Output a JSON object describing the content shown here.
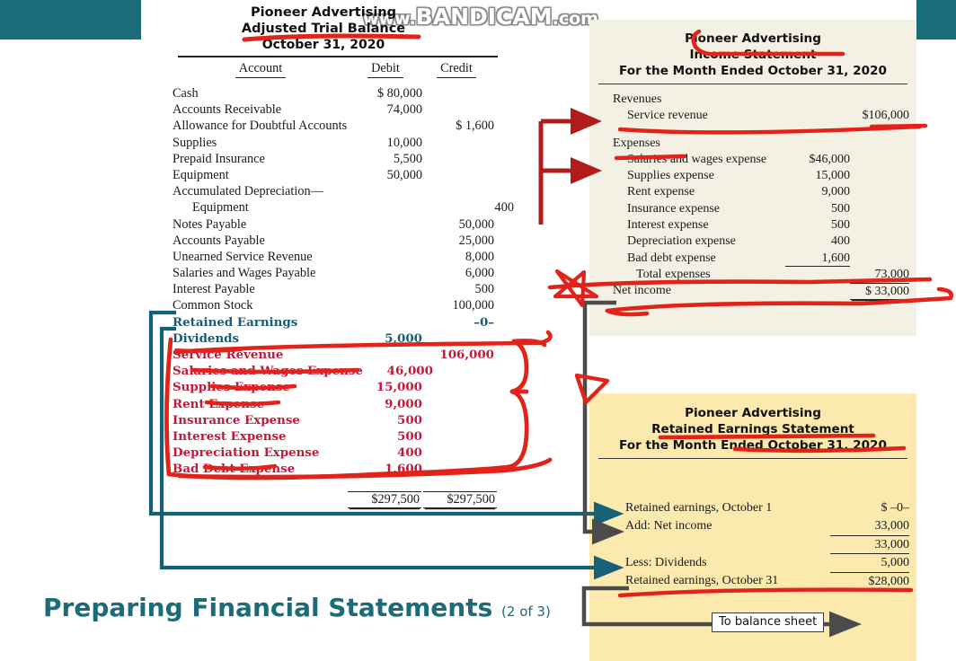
{
  "watermark": {
    "prefix": "www.",
    "brand": "BANDICAM",
    "suffix": ".com"
  },
  "colors": {
    "teal": "#1b6b78",
    "red_annotation": "#e2231a",
    "dark_red_arrow": "#b01c1c",
    "cream_panel": "#f2f1e4",
    "yellow_panel": "#fbe9ae",
    "gray_connector": "#4b4b4b",
    "teal_connector": "#16607a",
    "red_text": "#c2183c"
  },
  "page_title": {
    "text": "Preparing Financial Statements",
    "count": "(2 of 3)"
  },
  "to_balance_sheet": {
    "label": "To balance sheet"
  },
  "trial_balance": {
    "company": "Pioneer Advertising",
    "statement": "Adjusted Trial Balance",
    "date": "October 31, 2020",
    "columns": {
      "account": "Account",
      "debit": "Debit",
      "credit": "Credit"
    },
    "rows": [
      {
        "account": "Cash",
        "debit": "$ 80,000",
        "credit": "",
        "style": "normal"
      },
      {
        "account": "Accounts Receivable",
        "debit": "74,000",
        "credit": "",
        "style": "normal"
      },
      {
        "account": "Allowance for Doubtful Accounts",
        "debit": "",
        "credit": "$  1,600",
        "style": "normal"
      },
      {
        "account": "Supplies",
        "debit": "10,000",
        "credit": "",
        "style": "normal"
      },
      {
        "account": "Prepaid Insurance",
        "debit": "5,500",
        "credit": "",
        "style": "normal"
      },
      {
        "account": "Equipment",
        "debit": "50,000",
        "credit": "",
        "style": "normal"
      },
      {
        "account": "Accumulated Depreciation—",
        "debit": "",
        "credit": "",
        "style": "normal"
      },
      {
        "account": "Equipment",
        "debit": "",
        "credit": "400",
        "style": "indent"
      },
      {
        "account": "Notes Payable",
        "debit": "",
        "credit": "50,000",
        "style": "normal"
      },
      {
        "account": "Accounts Payable",
        "debit": "",
        "credit": "25,000",
        "style": "normal"
      },
      {
        "account": "Unearned Service Revenue",
        "debit": "",
        "credit": "8,000",
        "style": "normal"
      },
      {
        "account": "Salaries and Wages Payable",
        "debit": "",
        "credit": "6,000",
        "style": "normal"
      },
      {
        "account": "Interest Payable",
        "debit": "",
        "credit": "500",
        "style": "normal"
      },
      {
        "account": "Common Stock",
        "debit": "",
        "credit": "100,000",
        "style": "normal"
      },
      {
        "account": "Retained Earnings",
        "debit": "",
        "credit": "–0–",
        "style": "teal"
      },
      {
        "account": "Dividends",
        "debit": "5,000",
        "credit": "",
        "style": "teal"
      },
      {
        "account": "Service Revenue",
        "debit": "",
        "credit": "106,000",
        "style": "red"
      },
      {
        "account": "Salaries and Wages Expense",
        "debit": "46,000",
        "credit": "",
        "style": "red"
      },
      {
        "account": "Supplies Expense",
        "debit": "15,000",
        "credit": "",
        "style": "red"
      },
      {
        "account": "Rent Expense",
        "debit": "9,000",
        "credit": "",
        "style": "red"
      },
      {
        "account": "Insurance Expense",
        "debit": "500",
        "credit": "",
        "style": "red"
      },
      {
        "account": "Interest Expense",
        "debit": "500",
        "credit": "",
        "style": "red"
      },
      {
        "account": "Depreciation Expense",
        "debit": "400",
        "credit": "",
        "style": "red"
      },
      {
        "account": "Bad Debt Expense",
        "debit": "1,600",
        "credit": "",
        "style": "red"
      }
    ],
    "totals": {
      "debit": "$297,500",
      "credit": "$297,500"
    }
  },
  "income_statement": {
    "company": "Pioneer Advertising",
    "statement": "Income Statement",
    "period": "For the Month Ended October 31, 2020",
    "revenues_heading": "Revenues",
    "revenue_line": {
      "label": "Service revenue",
      "value": "$106,000"
    },
    "expenses_heading": "Expenses",
    "expense_lines": [
      {
        "label": "Salaries and wages expense",
        "value": "$46,000"
      },
      {
        "label": "Supplies expense",
        "value": "15,000"
      },
      {
        "label": "Rent expense",
        "value": "9,000"
      },
      {
        "label": "Insurance expense",
        "value": "500"
      },
      {
        "label": "Interest expense",
        "value": "500"
      },
      {
        "label": "Depreciation expense",
        "value": "400"
      },
      {
        "label": "Bad debt expense",
        "value": "1,600"
      }
    ],
    "total_expenses": {
      "label": "Total expenses",
      "value": "73,000"
    },
    "net_income": {
      "label": "Net income",
      "value": "$ 33,000"
    }
  },
  "retained_earnings_statement": {
    "company": "Pioneer Advertising",
    "statement": "Retained Earnings Statement",
    "period": "For the Month Ended October 31, 2020",
    "rows": [
      {
        "label": "Retained earnings, October 1",
        "value": "$    –0–"
      },
      {
        "label": "Add: Net income",
        "value": "33,000"
      },
      {
        "label": "",
        "value": "33,000"
      },
      {
        "label": "Less: Dividends",
        "value": "5,000"
      },
      {
        "label": "Retained earnings, October 31",
        "value": "$28,000"
      }
    ]
  }
}
